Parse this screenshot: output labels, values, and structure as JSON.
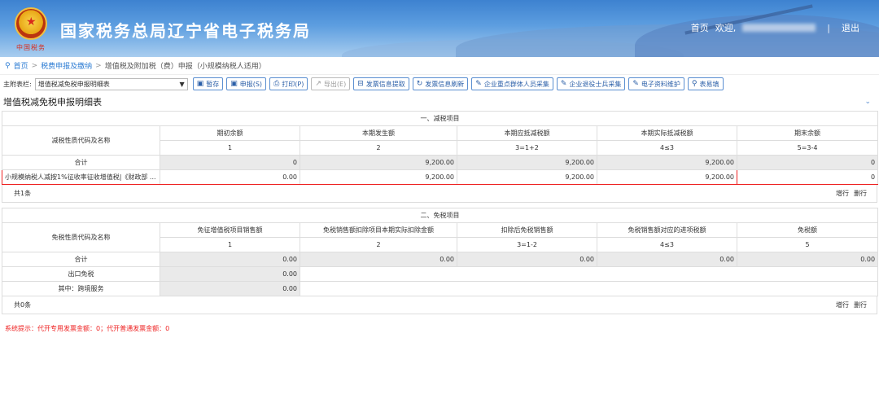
{
  "header": {
    "emblem_text": "中国税务",
    "site_title": "国家税务总局辽宁省电子税务局",
    "nav_home": "首页",
    "nav_welcome": "欢迎,",
    "nav_separator": "|",
    "nav_logout": "退出"
  },
  "breadcrumb": {
    "home": "首页",
    "arrow": ">",
    "item1": "税费申报及缴纳",
    "item2": "增值税及附加税（费）申报（小规模纳税人适用）"
  },
  "toolbar": {
    "label": "主附表栏:",
    "select_value": "增值税减免税申报明细表",
    "buttons": [
      "暂存",
      "申报(S)",
      "打印(P)",
      "导出(E)",
      "发票信息提取",
      "发票信息刷新",
      "企业重点群体人员采集",
      "企业退役士兵采集",
      "电子资料维护",
      "表易填"
    ]
  },
  "section_title": "增值税减免税申报明细表",
  "reduction": {
    "title": "一、减税项目",
    "row_label_header": "减税性质代码及名称",
    "columns": [
      "期初余额",
      "本期发生额",
      "本期应抵减税额",
      "本期实际抵减税额",
      "期末余额"
    ],
    "column_numbers": [
      "1",
      "2",
      "3=1+2",
      "4≤3",
      "5=3-4"
    ],
    "total_label": "合计",
    "total_values": [
      "0",
      "9,200.00",
      "9,200.00",
      "9,200.00",
      "0"
    ],
    "rows": [
      {
        "label": "小规模纳税人减按1%征收率征收增值税|《财政部 ...",
        "values": [
          "0.00",
          "9,200.00",
          "9,200.00",
          "9,200.00",
          "0"
        ]
      }
    ],
    "count": "共1条",
    "add_row": "增行",
    "delete_row": "删行"
  },
  "exemption": {
    "title": "二、免税项目",
    "row_label_header": "免税性质代码及名称",
    "columns": [
      "免征增值税项目销售额",
      "免税销售额扣除项目本期实际扣除金额",
      "扣除后免税销售额",
      "免税销售额对应的进项税额",
      "免税额"
    ],
    "column_numbers": [
      "1",
      "2",
      "3=1-2",
      "4≤3",
      "5"
    ],
    "total_label": "合计",
    "total_values": [
      "0.00",
      "0.00",
      "0.00",
      "0.00",
      "0.00"
    ],
    "export_label": "出口免税",
    "export_value": "0.00",
    "crossborder_label": "其中：跨境服务",
    "crossborder_value": "0.00",
    "count": "共0条",
    "add_row": "增行",
    "delete_row": "删行"
  },
  "system_tip": "系统提示：代开专用发票金额：0；代开普通发票金额：0",
  "colors": {
    "accent": "#2b7bd3",
    "highlight": "#e22222",
    "gray_cell": "#eaeaea"
  }
}
